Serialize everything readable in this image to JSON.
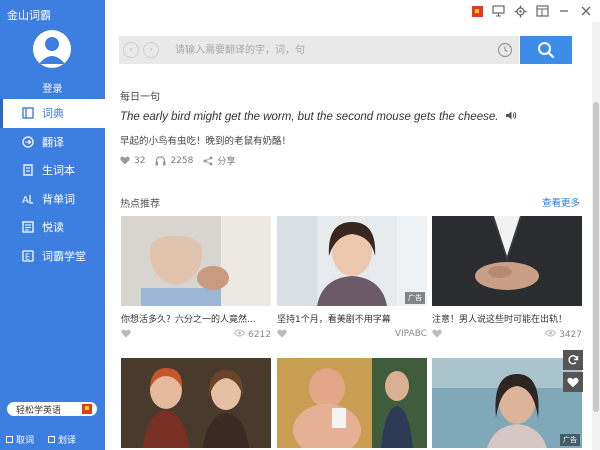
{
  "app": {
    "title": "金山词霸",
    "login": "登录"
  },
  "sidebar": {
    "items": [
      {
        "label": "词典",
        "icon": "book-icon"
      },
      {
        "label": "翻译",
        "icon": "translate-icon"
      },
      {
        "label": "生词本",
        "icon": "notebook-icon"
      },
      {
        "label": "背单词",
        "icon": "memorize-icon"
      },
      {
        "label": "悦读",
        "icon": "reading-icon"
      },
      {
        "label": "词霸学堂",
        "icon": "classroom-icon"
      }
    ],
    "promo": "轻松学英语",
    "footer": {
      "option1": "取词",
      "option2": "划译"
    }
  },
  "search": {
    "placeholder": "请输入需要翻译的字，词，句"
  },
  "daily": {
    "title": "每日一句",
    "english": "The early bird might get the worm, but the second mouse gets the cheese.",
    "chinese": "早起的小鸟有虫吃！晚到的老鼠有奶酪！",
    "likes": "32",
    "listens": "2258",
    "share": "分享"
  },
  "hot": {
    "title": "热点推荐",
    "see_more": "查看更多",
    "cards": [
      {
        "caption": "你想活多久？六分之一的人竟然...",
        "count": "6212",
        "source": ""
      },
      {
        "caption": "坚持1个月，看美剧不用字幕",
        "count": "",
        "source": "VIPABC",
        "ad": "广告"
      },
      {
        "caption": "注意！男人说这些时可能在出轨！",
        "count": "3427",
        "source": ""
      },
      {
        "caption": "",
        "count": "",
        "source": ""
      },
      {
        "caption": "",
        "count": "",
        "source": ""
      },
      {
        "caption": "",
        "count": "",
        "source": "",
        "ad": "广告"
      }
    ]
  },
  "colors": {
    "accent": "#3d7fe0",
    "search_button": "#3d8de8",
    "link": "#2a7ad8"
  }
}
